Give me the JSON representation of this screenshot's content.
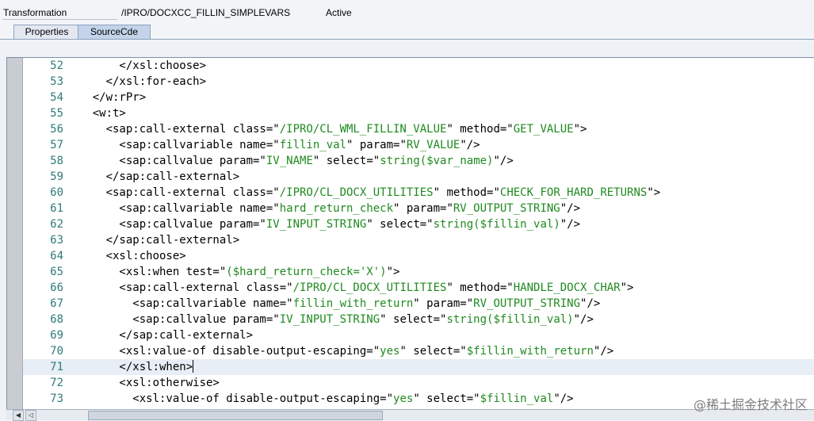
{
  "header": {
    "type_label": "Transformation",
    "name": "/IPRO/DOCXCC_FILLIN_SIMPLEVARS",
    "status": "Active"
  },
  "tabs": [
    {
      "label": "Properties"
    },
    {
      "label": "SourceCde"
    }
  ],
  "editor": {
    "lines": [
      {
        "num": "52",
        "code": "        </xsl:choose>"
      },
      {
        "num": "53",
        "code": "      </xsl:for-each>"
      },
      {
        "num": "54",
        "code": "    </w:rPr>"
      },
      {
        "num": "55",
        "code": "    <w:t>"
      },
      {
        "num": "56",
        "code": "      <sap:call-external class=\"/IPRO/CL_WML_FILLIN_VALUE\" method=\"GET_VALUE\">"
      },
      {
        "num": "57",
        "code": "        <sap:callvariable name=\"fillin_val\" param=\"RV_VALUE\"/>"
      },
      {
        "num": "58",
        "code": "        <sap:callvalue param=\"IV_NAME\" select=\"string($var_name)\"/>"
      },
      {
        "num": "59",
        "code": "      </sap:call-external>"
      },
      {
        "num": "60",
        "code": "      <sap:call-external class=\"/IPRO/CL_DOCX_UTILITIES\" method=\"CHECK_FOR_HARD_RETURNS\">"
      },
      {
        "num": "61",
        "code": "        <sap:callvariable name=\"hard_return_check\" param=\"RV_OUTPUT_STRING\"/>"
      },
      {
        "num": "62",
        "code": "        <sap:callvalue param=\"IV_INPUT_STRING\" select=\"string($fillin_val)\"/>"
      },
      {
        "num": "63",
        "code": "      </sap:call-external>"
      },
      {
        "num": "64",
        "code": "      <xsl:choose>"
      },
      {
        "num": "65",
        "code": "        <xsl:when test=\"($hard_return_check='X')\">"
      },
      {
        "num": "66",
        "code": "        <sap:call-external class=\"/IPRO/CL_DOCX_UTILITIES\" method=\"HANDLE_DOCX_CHAR\">"
      },
      {
        "num": "67",
        "code": "          <sap:callvariable name=\"fillin_with_return\" param=\"RV_OUTPUT_STRING\"/>"
      },
      {
        "num": "68",
        "code": "          <sap:callvalue param=\"IV_INPUT_STRING\" select=\"string($fillin_val)\"/>"
      },
      {
        "num": "69",
        "code": "        </sap:call-external>"
      },
      {
        "num": "70",
        "code": "        <xsl:value-of disable-output-escaping=\"yes\" select=\"$fillin_with_return\"/>"
      },
      {
        "num": "71",
        "code": "        </xsl:when>"
      },
      {
        "num": "72",
        "code": "        <xsl:otherwise>"
      },
      {
        "num": "73",
        "code": "          <xsl:value-of disable-output-escaping=\"yes\" select=\"$fillin_val\"/>"
      }
    ],
    "current_line": "71"
  },
  "watermark": "@稀土掘金技术社区"
}
